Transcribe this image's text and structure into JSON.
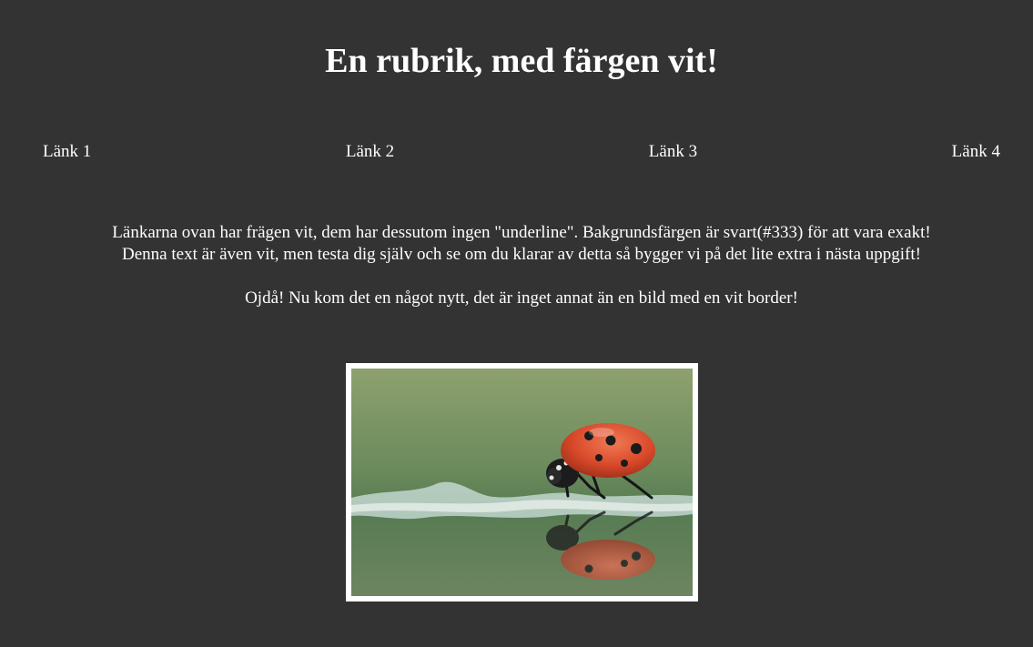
{
  "header": {
    "title": "En rubrik, med färgen vit!"
  },
  "nav": {
    "links": [
      "Länk 1",
      "Länk 2",
      "Länk 3",
      "Länk 4"
    ]
  },
  "content": {
    "line1": "Länkarna ovan har frägen vit, dem har dessutom ingen \"underline\". Bakgrundsfärgen är svart(#333) för att vara exakt!",
    "line2": "Denna text är även vit, men testa dig själv och se om du klarar av detta så bygger vi på det lite extra i nästa uppgift!",
    "line3": "Ojdå! Nu kom det en något nytt, det är inget annat än en bild med en vit border!"
  },
  "image": {
    "subject": "ladybug-on-water"
  },
  "colors": {
    "background": "#333333",
    "text": "#ffffff",
    "image_border": "#ffffff"
  }
}
